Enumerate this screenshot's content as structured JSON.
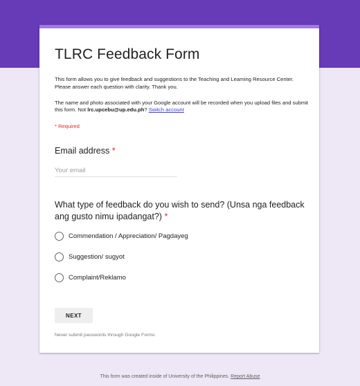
{
  "form": {
    "title": "TLRC Feedback Form",
    "description": "This form allows you to give feedback and suggestions to the Teaching and Learning Resource Center. Please answer each question with clarity. Thank you.",
    "notice_text": "The name and photo associated with your Google account will be recorded when you upload files and submit this form. Not ",
    "notice_account": "lrc.upcebu@up.edu.ph",
    "notice_suffix": "? ",
    "switch_account_label": "Switch account",
    "required_note": "* Required"
  },
  "questions": {
    "email": {
      "label": "Email address",
      "required_mark": "*",
      "placeholder": "Your email",
      "value": ""
    },
    "feedback_type": {
      "label": "What type of feedback do you wish to send? (Unsa nga feedback ang gusto nimu ipadangat?)",
      "required_mark": "*",
      "options": [
        "Commendation / Appreciation/ Pagdayeg",
        "Suggestion/ sugyot",
        "Complaint/Reklamo"
      ]
    }
  },
  "actions": {
    "next_label": "NEXT",
    "password_warning": "Never submit passwords through Google Forms."
  },
  "footer": {
    "text": "This form was created inside of University of the Philippines. ",
    "report_label": "Report Abuse"
  },
  "colors": {
    "header_band": "#673ab7",
    "card_accent": "#a07ae0",
    "page_background": "#ede7f6",
    "required": "#d93025",
    "link": "#3c3cd8"
  }
}
